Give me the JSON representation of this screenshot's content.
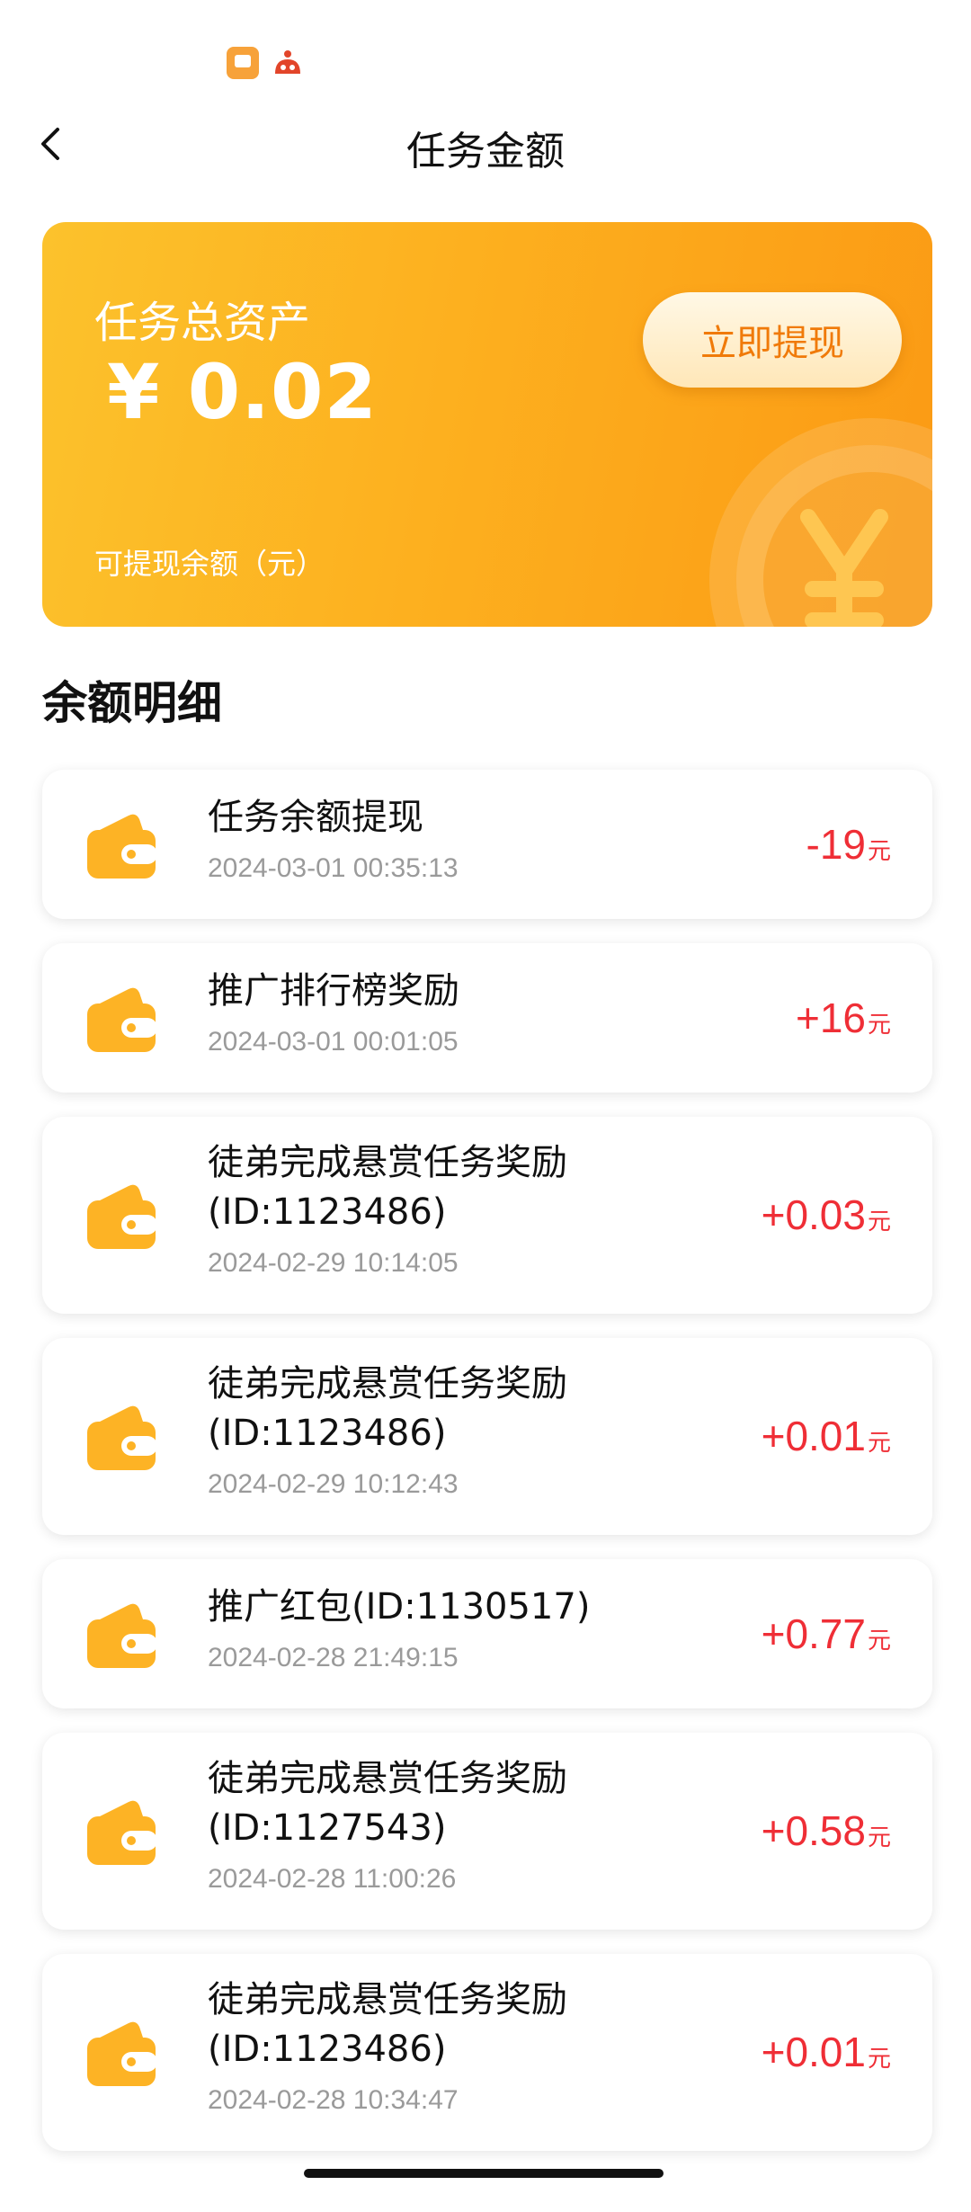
{
  "header": {
    "title": "任务金额"
  },
  "asset_card": {
    "title": "任务总资产",
    "amount": "¥ 0.02",
    "subtitle": "可提现余额（元）",
    "withdraw_label": "立即提现"
  },
  "section": {
    "title": "余额明细"
  },
  "records": [
    {
      "title": "任务余额提现",
      "time": "2024-03-01 00:35:13",
      "amount": "-19",
      "unit": "元"
    },
    {
      "title": "推广排行榜奖励",
      "time": "2024-03-01 00:01:05",
      "amount": "+16",
      "unit": "元"
    },
    {
      "title": "徒弟完成悬赏任务奖励 (ID:1123486)",
      "time": "2024-02-29 10:14:05",
      "amount": "+0.03",
      "unit": "元"
    },
    {
      "title": "徒弟完成悬赏任务奖励 (ID:1123486)",
      "time": "2024-02-29 10:12:43",
      "amount": "+0.01",
      "unit": "元"
    },
    {
      "title": "推广红包(ID:1130517)",
      "time": "2024-02-28 21:49:15",
      "amount": "+0.77",
      "unit": "元"
    },
    {
      "title": "徒弟完成悬赏任务奖励 (ID:1127543)",
      "time": "2024-02-28 11:00:26",
      "amount": "+0.58",
      "unit": "元"
    },
    {
      "title": "徒弟完成悬赏任务奖励 (ID:1123486)",
      "time": "2024-02-28 10:34:47",
      "amount": "+0.01",
      "unit": "元"
    }
  ],
  "colors": {
    "accent": "#fdb01f",
    "amount_red": "#ef2e36",
    "button_text": "#f07a09"
  }
}
